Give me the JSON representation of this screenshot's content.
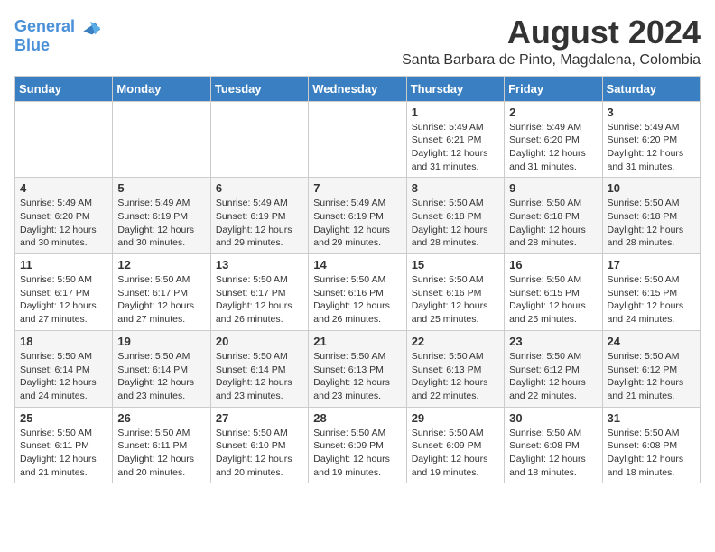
{
  "header": {
    "logo_line1": "General",
    "logo_line2": "Blue",
    "main_title": "August 2024",
    "subtitle": "Santa Barbara de Pinto, Magdalena, Colombia"
  },
  "calendar": {
    "days_of_week": [
      "Sunday",
      "Monday",
      "Tuesday",
      "Wednesday",
      "Thursday",
      "Friday",
      "Saturday"
    ],
    "weeks": [
      [
        {
          "num": "",
          "info": ""
        },
        {
          "num": "",
          "info": ""
        },
        {
          "num": "",
          "info": ""
        },
        {
          "num": "",
          "info": ""
        },
        {
          "num": "1",
          "info": "Sunrise: 5:49 AM\nSunset: 6:21 PM\nDaylight: 12 hours\nand 31 minutes."
        },
        {
          "num": "2",
          "info": "Sunrise: 5:49 AM\nSunset: 6:20 PM\nDaylight: 12 hours\nand 31 minutes."
        },
        {
          "num": "3",
          "info": "Sunrise: 5:49 AM\nSunset: 6:20 PM\nDaylight: 12 hours\nand 31 minutes."
        }
      ],
      [
        {
          "num": "4",
          "info": "Sunrise: 5:49 AM\nSunset: 6:20 PM\nDaylight: 12 hours\nand 30 minutes."
        },
        {
          "num": "5",
          "info": "Sunrise: 5:49 AM\nSunset: 6:19 PM\nDaylight: 12 hours\nand 30 minutes."
        },
        {
          "num": "6",
          "info": "Sunrise: 5:49 AM\nSunset: 6:19 PM\nDaylight: 12 hours\nand 29 minutes."
        },
        {
          "num": "7",
          "info": "Sunrise: 5:49 AM\nSunset: 6:19 PM\nDaylight: 12 hours\nand 29 minutes."
        },
        {
          "num": "8",
          "info": "Sunrise: 5:50 AM\nSunset: 6:18 PM\nDaylight: 12 hours\nand 28 minutes."
        },
        {
          "num": "9",
          "info": "Sunrise: 5:50 AM\nSunset: 6:18 PM\nDaylight: 12 hours\nand 28 minutes."
        },
        {
          "num": "10",
          "info": "Sunrise: 5:50 AM\nSunset: 6:18 PM\nDaylight: 12 hours\nand 28 minutes."
        }
      ],
      [
        {
          "num": "11",
          "info": "Sunrise: 5:50 AM\nSunset: 6:17 PM\nDaylight: 12 hours\nand 27 minutes."
        },
        {
          "num": "12",
          "info": "Sunrise: 5:50 AM\nSunset: 6:17 PM\nDaylight: 12 hours\nand 27 minutes."
        },
        {
          "num": "13",
          "info": "Sunrise: 5:50 AM\nSunset: 6:17 PM\nDaylight: 12 hours\nand 26 minutes."
        },
        {
          "num": "14",
          "info": "Sunrise: 5:50 AM\nSunset: 6:16 PM\nDaylight: 12 hours\nand 26 minutes."
        },
        {
          "num": "15",
          "info": "Sunrise: 5:50 AM\nSunset: 6:16 PM\nDaylight: 12 hours\nand 25 minutes."
        },
        {
          "num": "16",
          "info": "Sunrise: 5:50 AM\nSunset: 6:15 PM\nDaylight: 12 hours\nand 25 minutes."
        },
        {
          "num": "17",
          "info": "Sunrise: 5:50 AM\nSunset: 6:15 PM\nDaylight: 12 hours\nand 24 minutes."
        }
      ],
      [
        {
          "num": "18",
          "info": "Sunrise: 5:50 AM\nSunset: 6:14 PM\nDaylight: 12 hours\nand 24 minutes."
        },
        {
          "num": "19",
          "info": "Sunrise: 5:50 AM\nSunset: 6:14 PM\nDaylight: 12 hours\nand 23 minutes."
        },
        {
          "num": "20",
          "info": "Sunrise: 5:50 AM\nSunset: 6:14 PM\nDaylight: 12 hours\nand 23 minutes."
        },
        {
          "num": "21",
          "info": "Sunrise: 5:50 AM\nSunset: 6:13 PM\nDaylight: 12 hours\nand 23 minutes."
        },
        {
          "num": "22",
          "info": "Sunrise: 5:50 AM\nSunset: 6:13 PM\nDaylight: 12 hours\nand 22 minutes."
        },
        {
          "num": "23",
          "info": "Sunrise: 5:50 AM\nSunset: 6:12 PM\nDaylight: 12 hours\nand 22 minutes."
        },
        {
          "num": "24",
          "info": "Sunrise: 5:50 AM\nSunset: 6:12 PM\nDaylight: 12 hours\nand 21 minutes."
        }
      ],
      [
        {
          "num": "25",
          "info": "Sunrise: 5:50 AM\nSunset: 6:11 PM\nDaylight: 12 hours\nand 21 minutes."
        },
        {
          "num": "26",
          "info": "Sunrise: 5:50 AM\nSunset: 6:11 PM\nDaylight: 12 hours\nand 20 minutes."
        },
        {
          "num": "27",
          "info": "Sunrise: 5:50 AM\nSunset: 6:10 PM\nDaylight: 12 hours\nand 20 minutes."
        },
        {
          "num": "28",
          "info": "Sunrise: 5:50 AM\nSunset: 6:09 PM\nDaylight: 12 hours\nand 19 minutes."
        },
        {
          "num": "29",
          "info": "Sunrise: 5:50 AM\nSunset: 6:09 PM\nDaylight: 12 hours\nand 19 minutes."
        },
        {
          "num": "30",
          "info": "Sunrise: 5:50 AM\nSunset: 6:08 PM\nDaylight: 12 hours\nand 18 minutes."
        },
        {
          "num": "31",
          "info": "Sunrise: 5:50 AM\nSunset: 6:08 PM\nDaylight: 12 hours\nand 18 minutes."
        }
      ]
    ]
  }
}
